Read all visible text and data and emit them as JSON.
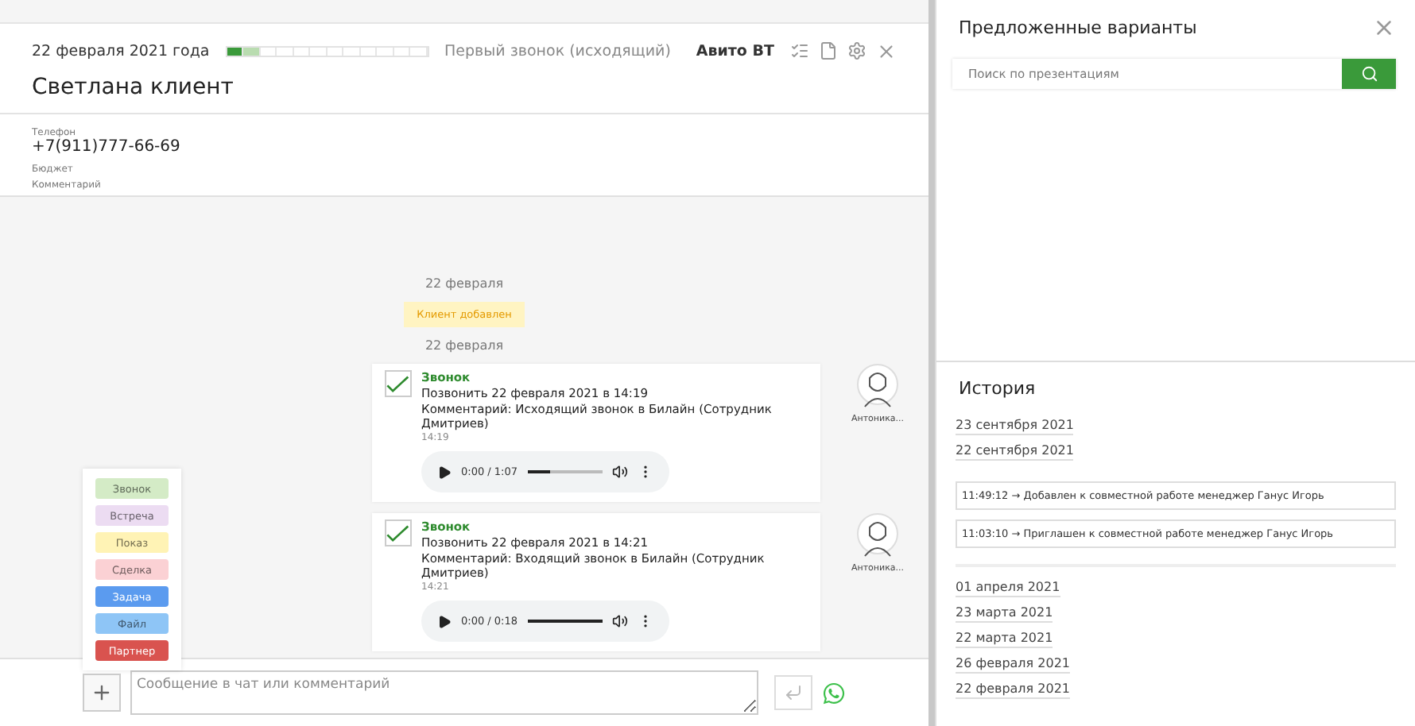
{
  "deal": {
    "date": "22 февраля 2021 года",
    "stages": [
      {
        "kind": "done"
      },
      {
        "kind": "current"
      },
      {
        "kind": "empty"
      },
      {
        "kind": "empty"
      },
      {
        "kind": "empty"
      },
      {
        "kind": "empty"
      },
      {
        "kind": "empty"
      },
      {
        "kind": "empty"
      },
      {
        "kind": "empty"
      },
      {
        "kind": "empty"
      },
      {
        "kind": "empty"
      },
      {
        "kind": "empty"
      }
    ],
    "stage_name": "Первый звонок (исходящий)",
    "source": "Авито ВТ",
    "title": "Светлана клиент",
    "fields": [
      {
        "label": "Телефон",
        "value": "+7(911)777-66-69"
      },
      {
        "label": "Бюджет"
      },
      {
        "label": "Комментарий"
      }
    ]
  },
  "feed": [
    {
      "kind": "date",
      "text": "22 февраля"
    },
    {
      "kind": "badge",
      "text": "Клиент добавлен"
    },
    {
      "kind": "date",
      "text": "22 февраля"
    },
    {
      "kind": "call",
      "checked": true,
      "type": "Звонок",
      "when": "Позвонить 22 февраля 2021 в 14:19",
      "comment": "Комментарий: Исходящий звонок в Билайн (Сотрудник Дмитриев)",
      "time": "14:19",
      "player": {
        "time": "0:00 / 1:07",
        "level": 0.3
      },
      "author": "Антоника..."
    },
    {
      "kind": "call",
      "checked": true,
      "type": "Звонок",
      "when": "Позвонить 22 февраля 2021 в 14:21",
      "comment": "Комментарий: Входящий звонок в Билайн (Сотрудник Дмитриев)",
      "time": "14:21",
      "player": {
        "time": "0:00 / 0:18",
        "level": 1
      },
      "author": "Антоника..."
    }
  ],
  "type_menu": [
    {
      "label": "Звонок",
      "color": "#d4ebc6"
    },
    {
      "label": "Встреча",
      "color": "#ecdcf2"
    },
    {
      "label": "Показ",
      "color": "#fff3b5"
    },
    {
      "label": "Сделка",
      "color": "#fbd1d4"
    },
    {
      "label": "Задача",
      "color": "#5b9bef"
    },
    {
      "label": "Файл",
      "color": "#8ec5f6"
    },
    {
      "label": "Партнер",
      "color": "#d9534f"
    }
  ],
  "composer": {
    "placeholder": "Сообщение в чат или комментарий"
  },
  "suggestions": {
    "title": "Предложенные варианты",
    "search_placeholder": "Поиск по презентациям"
  },
  "history": {
    "title": "История",
    "groups": [
      {
        "date": "23 сентября 2021"
      },
      {
        "date": "22 сентября 2021",
        "entries": [
          "11:49:12 → Добавлен к совместной работе менеджер Ганус Игорь",
          "11:03:10 → Приглашен к совместной работе менеджер Ганус Игорь"
        ]
      },
      {
        "date": "01 апреля 2021"
      },
      {
        "date": "23 марта 2021"
      },
      {
        "date": "22 марта 2021"
      },
      {
        "date": "26 февраля 2021"
      },
      {
        "date": "22 февраля 2021"
      }
    ]
  }
}
